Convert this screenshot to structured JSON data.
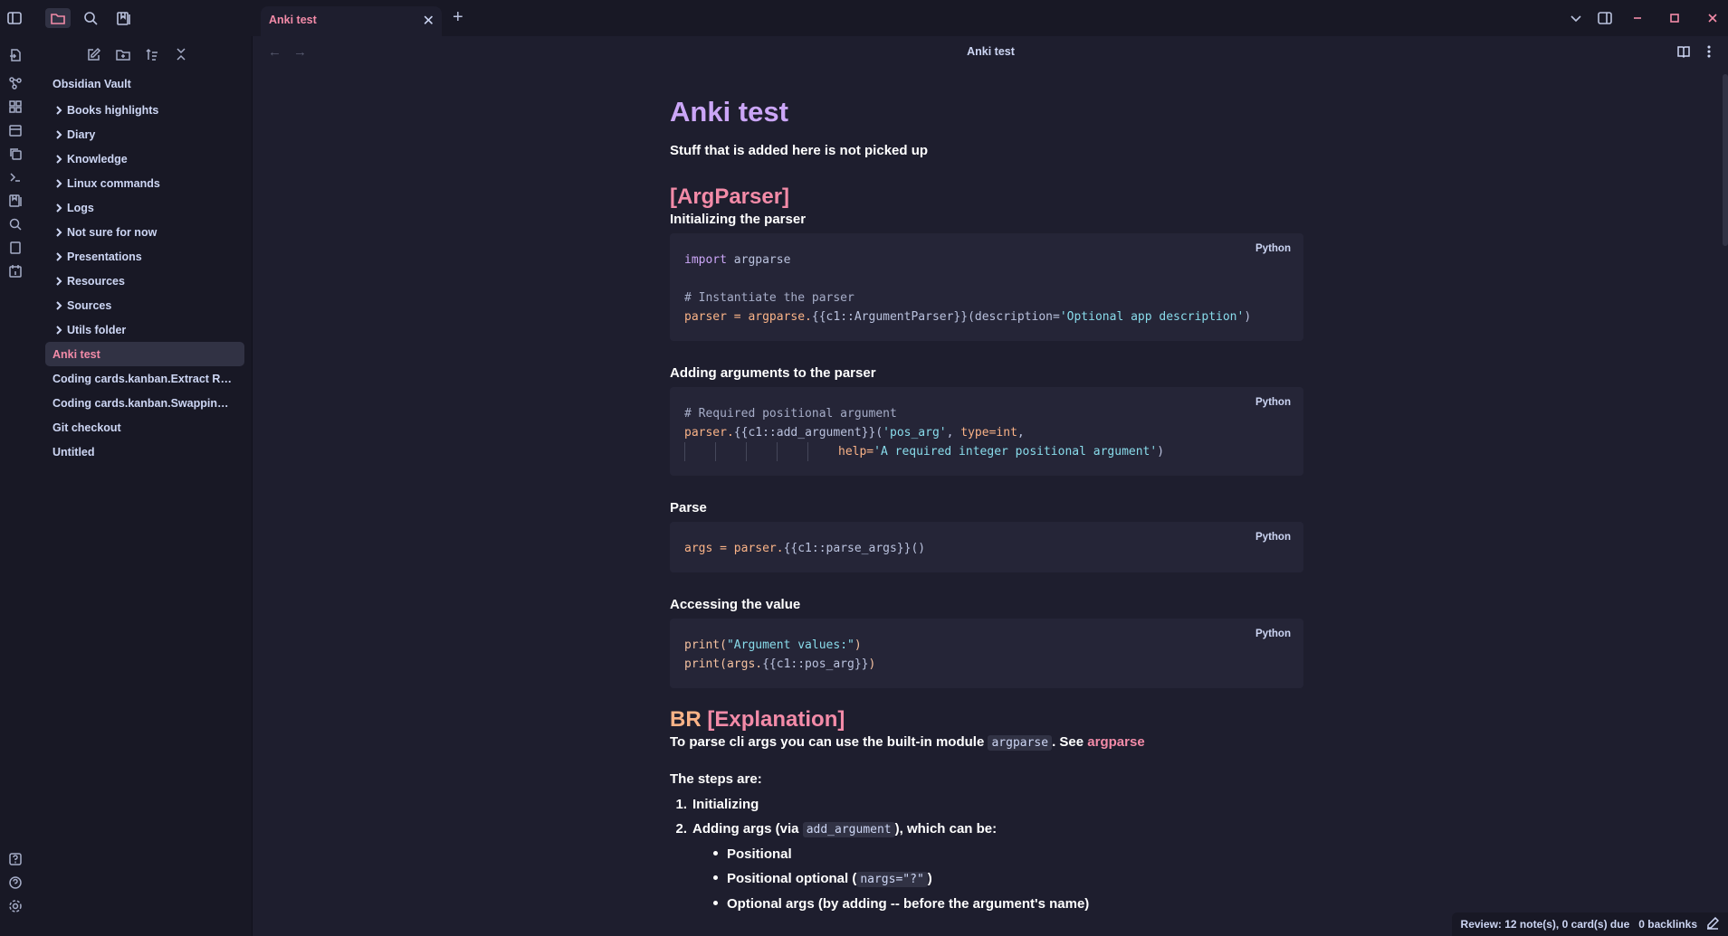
{
  "app": {
    "vault_name": "Obsidian Vault",
    "colors": {
      "accent": "#f38ba8",
      "heading1": "#cba6f7",
      "heading_br": "#fab387",
      "background": "#1e1e2e",
      "sidebar": "#181825"
    }
  },
  "titlebar": {
    "icons": [
      "sidebar-toggle-icon",
      "folder-icon",
      "search-icon",
      "bookmark-icon"
    ],
    "tab_title": "Anki test",
    "tab_close": "✕",
    "new_tab": "+",
    "window_controls": [
      "chevron-down-icon",
      "split-view-icon",
      "minimize-icon",
      "maximize-icon",
      "close-icon"
    ]
  },
  "ribbon": {
    "icons": [
      "open-note-icon",
      "graph-icon",
      "canvas-icon",
      "calendar-icon",
      "copy-icon",
      "terminal-icon",
      "anki-icon",
      "search-icon",
      "book-icon",
      "daily-note-icon",
      "help-question-icon",
      "help-icon",
      "settings-icon"
    ]
  },
  "sidebar": {
    "tools": [
      "new-note-icon",
      "new-folder-icon",
      "sort-icon",
      "collapse-icon"
    ],
    "folders": [
      "Books highlights",
      "Diary",
      "Knowledge",
      "Linux commands",
      "Logs",
      "Not sure for now",
      "Presentations",
      "Resources",
      "Sources",
      "Utils folder"
    ],
    "files": [
      "Anki test",
      "Coding cards.kanban.Extract Ref...",
      "Coding cards.kanban.Swapping ...",
      "Git checkout",
      "Untitled"
    ],
    "active_file": "Anki test"
  },
  "view": {
    "title": "Anki test",
    "back": "←",
    "forward": "→"
  },
  "note": {
    "h1": "Anki test",
    "intro": "Stuff that is added here is not picked up",
    "h2_argparser": "[ArgParser]",
    "sec1_label": "Initializing the parser",
    "code_lang": "Python",
    "sec2_label": "Adding arguments to the parser",
    "sec3_label": "Parse",
    "sec4_label": "Accessing the value",
    "h2_br": "BR",
    "h2_explanation": "[Explanation]",
    "expl_text_before": "To parse cli args you can use the built-in module",
    "expl_code": "argparse",
    "expl_text_mid": ". See",
    "expl_link": "argparse",
    "steps_intro": "The steps are:",
    "step1": "Initializing",
    "step2_before": "Adding args (via",
    "step2_code": "add_argument",
    "step2_after": "), which can be:",
    "sub1": "Positional",
    "sub2_before": "Positional optional (",
    "sub2_code": "nargs=\"?\"",
    "sub2_after": ")",
    "sub3": "Optional args (by adding -- before the argument's name)"
  },
  "code": {
    "b1": {
      "l1_kw": "import",
      "l1_rest": " argparse",
      "l3": "# Instantiate the parser",
      "l4_a": "parser = argparse.",
      "l4_b": "{{c1::ArgumentParser}}",
      "l4_c": "(description=",
      "l4_d": "'Optional app description'",
      "l4_e": ")"
    },
    "b2": {
      "l1": "# Required positional argument",
      "l2_a": "parser.",
      "l2_b": "{{c1::add_argument}}",
      "l2_c": "(",
      "l2_d": "'pos_arg'",
      "l2_e": ", ",
      "l2_f": "type=int",
      "l2_g": ",",
      "l3_a": "help=",
      "l3_b": "'A required integer positional argument'",
      "l3_c": ")"
    },
    "b3": {
      "l1_a": "args = parser.",
      "l1_b": "{{c1::parse_args}}",
      "l1_c": "()"
    },
    "b4": {
      "l1_a": "print(",
      "l1_b": "\"Argument values:\"",
      "l1_c": ")",
      "l2_a": "print(args.",
      "l2_b": "{{c1::pos_arg}}",
      "l2_c": ")"
    }
  },
  "statusbar": {
    "review": "Review: 12 note(s), 0 card(s) due",
    "backlinks": "0 backlinks"
  }
}
